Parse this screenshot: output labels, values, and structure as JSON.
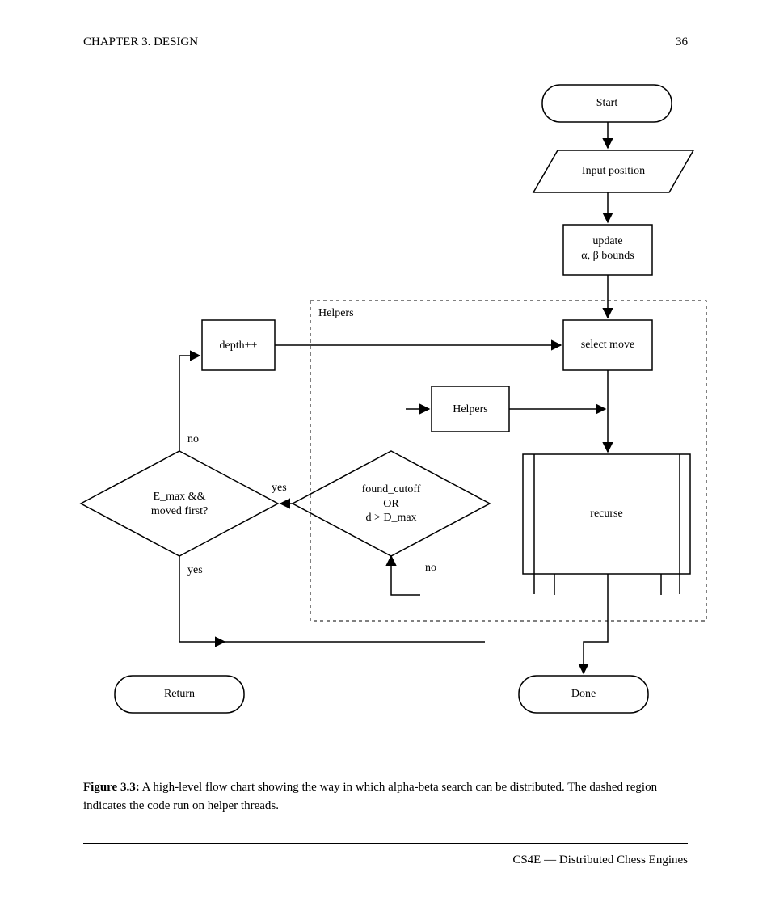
{
  "header": {
    "left": "CHAPTER 3. DESIGN",
    "right": "36"
  },
  "footer": {
    "right": "CS4E — Distributed Chess Engines"
  },
  "figure": {
    "caption_strong": "Figure 3.3:",
    "caption_rest": " A high-level flow chart showing the way in which alpha-beta search can be distributed. The dashed region indicates the code run on helper threads."
  },
  "nodes": {
    "start": {
      "label": "Start"
    },
    "input_position": {
      "label": "Input position"
    },
    "update_bounds": {
      "label": "update\nα, β bounds"
    },
    "select_move": {
      "label": "select move"
    },
    "inc_depth": {
      "label": "depth++"
    },
    "helper_region": {
      "label": "Helpers"
    },
    "recurse": {
      "label": "recurse"
    },
    "found_cutoff": {
      "label": "found_cutoff\nOR\nd > D_max"
    },
    "moved_first": {
      "label": "E_max &&\nmoved first?"
    },
    "return": {
      "label": "Return"
    },
    "done": {
      "label": "Done"
    }
  },
  "edges": {
    "found_cutoff_yes": "yes",
    "found_cutoff_no": "no",
    "moved_first_yes": "yes",
    "moved_first_no": "no"
  }
}
